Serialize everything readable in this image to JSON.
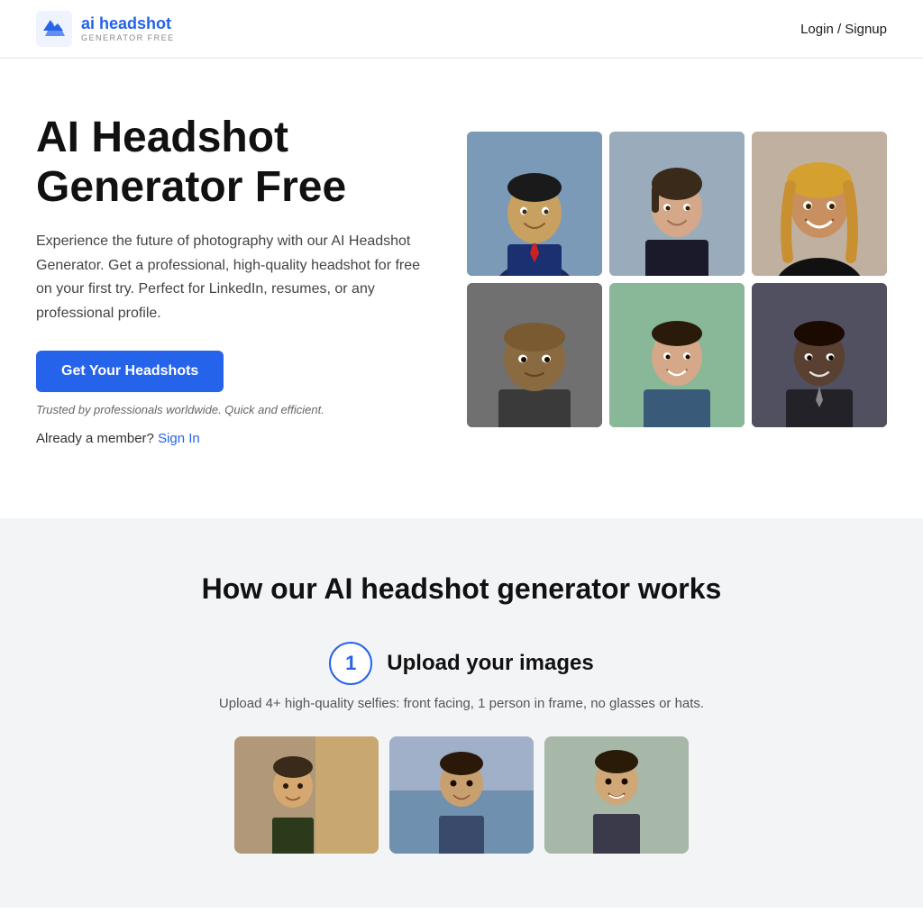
{
  "header": {
    "logo_main_ai": "ai",
    "logo_main_rest": " headshot",
    "logo_sub": "GENERATOR FREE",
    "nav_auth_label": "Login / Signup"
  },
  "hero": {
    "title": "AI Headshot Generator Free",
    "description": "Experience the future of photography with our AI Headshot Generator. Get a professional, high-quality headshot for free on your first try. Perfect for LinkedIn, resumes, or any professional profile.",
    "cta_label": "Get Your Headshots",
    "trust_text": "Trusted by professionals worldwide. Quick and efficient.",
    "member_text": "Already a member?",
    "signin_label": "Sign In"
  },
  "how_section": {
    "title": "How our AI headshot generator works",
    "step1": {
      "number": "1",
      "label": "Upload your images",
      "description": "Upload 4+ high-quality selfies: front facing, 1 person in frame, no glasses or hats."
    }
  },
  "colors": {
    "accent": "#2563eb",
    "text_primary": "#111",
    "text_secondary": "#444",
    "text_muted": "#666",
    "bg_section": "#f3f4f6"
  }
}
